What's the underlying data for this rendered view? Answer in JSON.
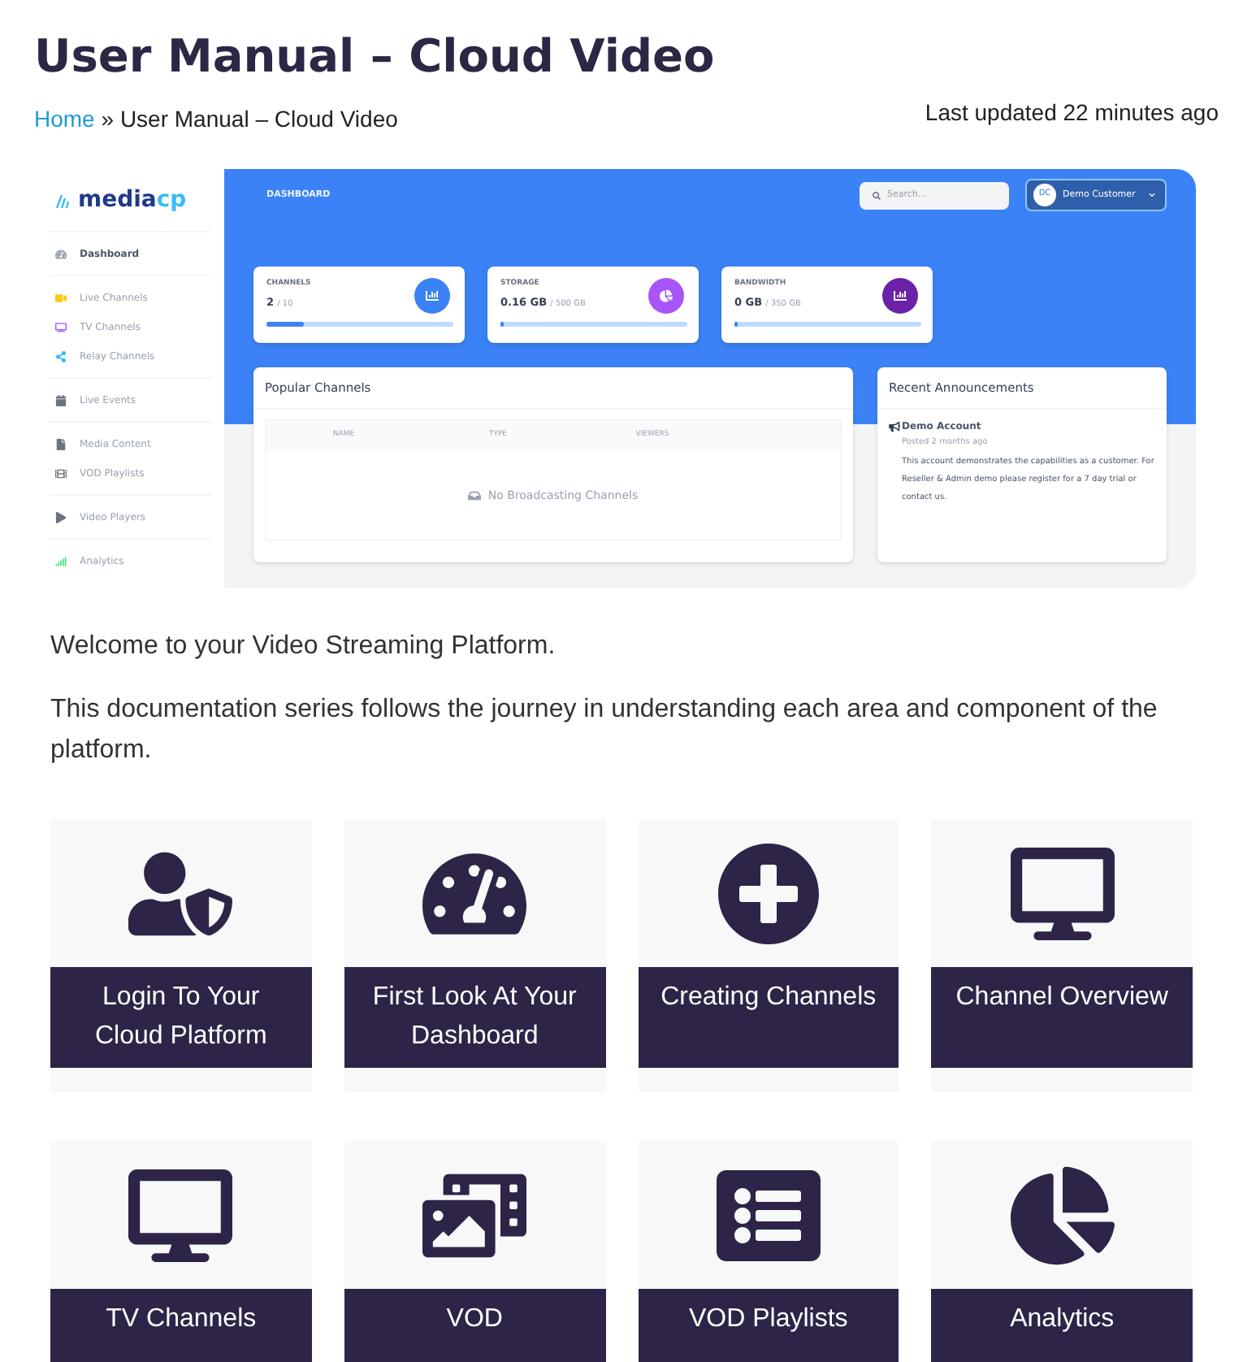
{
  "title": "User Manual – Cloud Video",
  "breadcrumb": {
    "home": "Home",
    "separator": "»",
    "current": "User Manual – Cloud Video"
  },
  "last_updated": "Last updated 22 minutes ago",
  "screenshot": {
    "logo": {
      "part1": "media",
      "part2": "cp"
    },
    "sidebar_groups": [
      [
        {
          "label": "Dashboard",
          "selected": true,
          "color": "#9ca3af"
        }
      ],
      [
        {
          "label": "Live Channels",
          "selected": false,
          "color": "#facc15"
        },
        {
          "label": "TV Channels",
          "selected": false,
          "color": "#a855f7"
        },
        {
          "label": "Relay Channels",
          "selected": false,
          "color": "#38bdf8"
        }
      ],
      [
        {
          "label": "Live Events",
          "selected": false,
          "color": "#6b7280"
        }
      ],
      [
        {
          "label": "Media Content",
          "selected": false,
          "color": "#6b7280"
        },
        {
          "label": "VOD Playlists",
          "selected": false,
          "color": "#6b7280"
        }
      ],
      [
        {
          "label": "Video Players",
          "selected": false,
          "color": "#6b7280"
        }
      ],
      [
        {
          "label": "Analytics",
          "selected": false,
          "color": "#4ade80"
        }
      ]
    ],
    "header_title": "DASHBOARD",
    "search": {
      "placeholder": "Search..."
    },
    "user": {
      "initials": "DC",
      "name": "Demo Customer"
    },
    "stats": [
      {
        "label": "CHANNELS",
        "value": "2",
        "limit": "/ 10",
        "level": 0.2,
        "color": "#3b82f6"
      },
      {
        "label": "STORAGE",
        "value": "0.16 GB",
        "limit": "/ 500 GB",
        "level": 0.02,
        "color": "#a855f7"
      },
      {
        "label": "BANDWIDTH",
        "value": "0 GB",
        "limit": "/ 350 GB",
        "level": 0.02,
        "color": "#6b21a8"
      }
    ],
    "popular": {
      "title": "Popular Channels",
      "columns": [
        "NAME",
        "TYPE",
        "VIEWERS"
      ],
      "empty": "No Broadcasting Channels"
    },
    "announcements": {
      "title": "Recent Announcements",
      "heading": "Demo Account",
      "posted": "Posted 2 months ago",
      "body": "This account demonstrates the capabilities as a customer. For Reseller & Admin demo please register for a 7 day trial or contact us."
    }
  },
  "paragraphs": [
    "Welcome to your Video Streaming Platform.",
    "This documentation series follows the journey in understanding each area and component of the platform."
  ],
  "tiles": [
    {
      "label": "Login To Your Cloud Platform"
    },
    {
      "label": "First Look At Your Dashboard"
    },
    {
      "label": "Creating Channels"
    },
    {
      "label": "Channel Overview"
    },
    {
      "label": "TV Channels"
    },
    {
      "label": "VOD"
    },
    {
      "label": "VOD Playlists"
    },
    {
      "label": "Analytics"
    }
  ]
}
